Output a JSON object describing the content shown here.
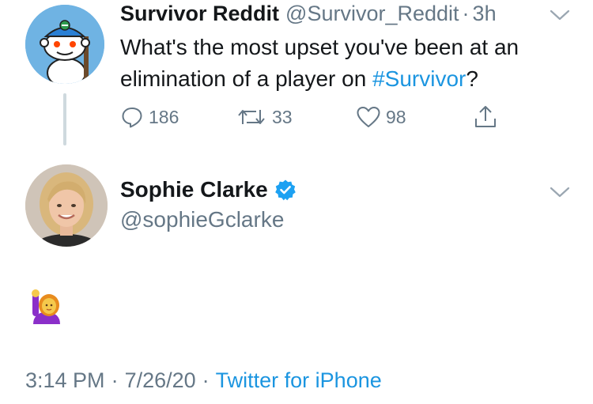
{
  "parent_tweet": {
    "display_name": "Survivor Reddit",
    "handle": "@Survivor_Reddit",
    "separator": "·",
    "time_ago": "3h",
    "text_before": "What's the most upset you've been at an elimination of a player on ",
    "hashtag": "#Survivor",
    "text_after": "?",
    "replies": "186",
    "retweets": "33",
    "likes": "98"
  },
  "reply_tweet": {
    "display_name": "Sophie Clarke",
    "handle": "@sophieGclarke",
    "time": "3:14 PM",
    "separator": "·",
    "date": "7/26/20",
    "source": "Twitter for iPhone"
  },
  "icons": {
    "reply": "reply-icon",
    "retweet": "retweet-icon",
    "like": "heart-icon",
    "share": "share-icon",
    "verified": "verified-badge-icon",
    "more": "chevron-down-icon",
    "emoji": "woman-raising-hand-emoji"
  },
  "colors": {
    "link_blue": "#1b95e0",
    "muted_gray": "#657786",
    "text": "#14171a"
  }
}
